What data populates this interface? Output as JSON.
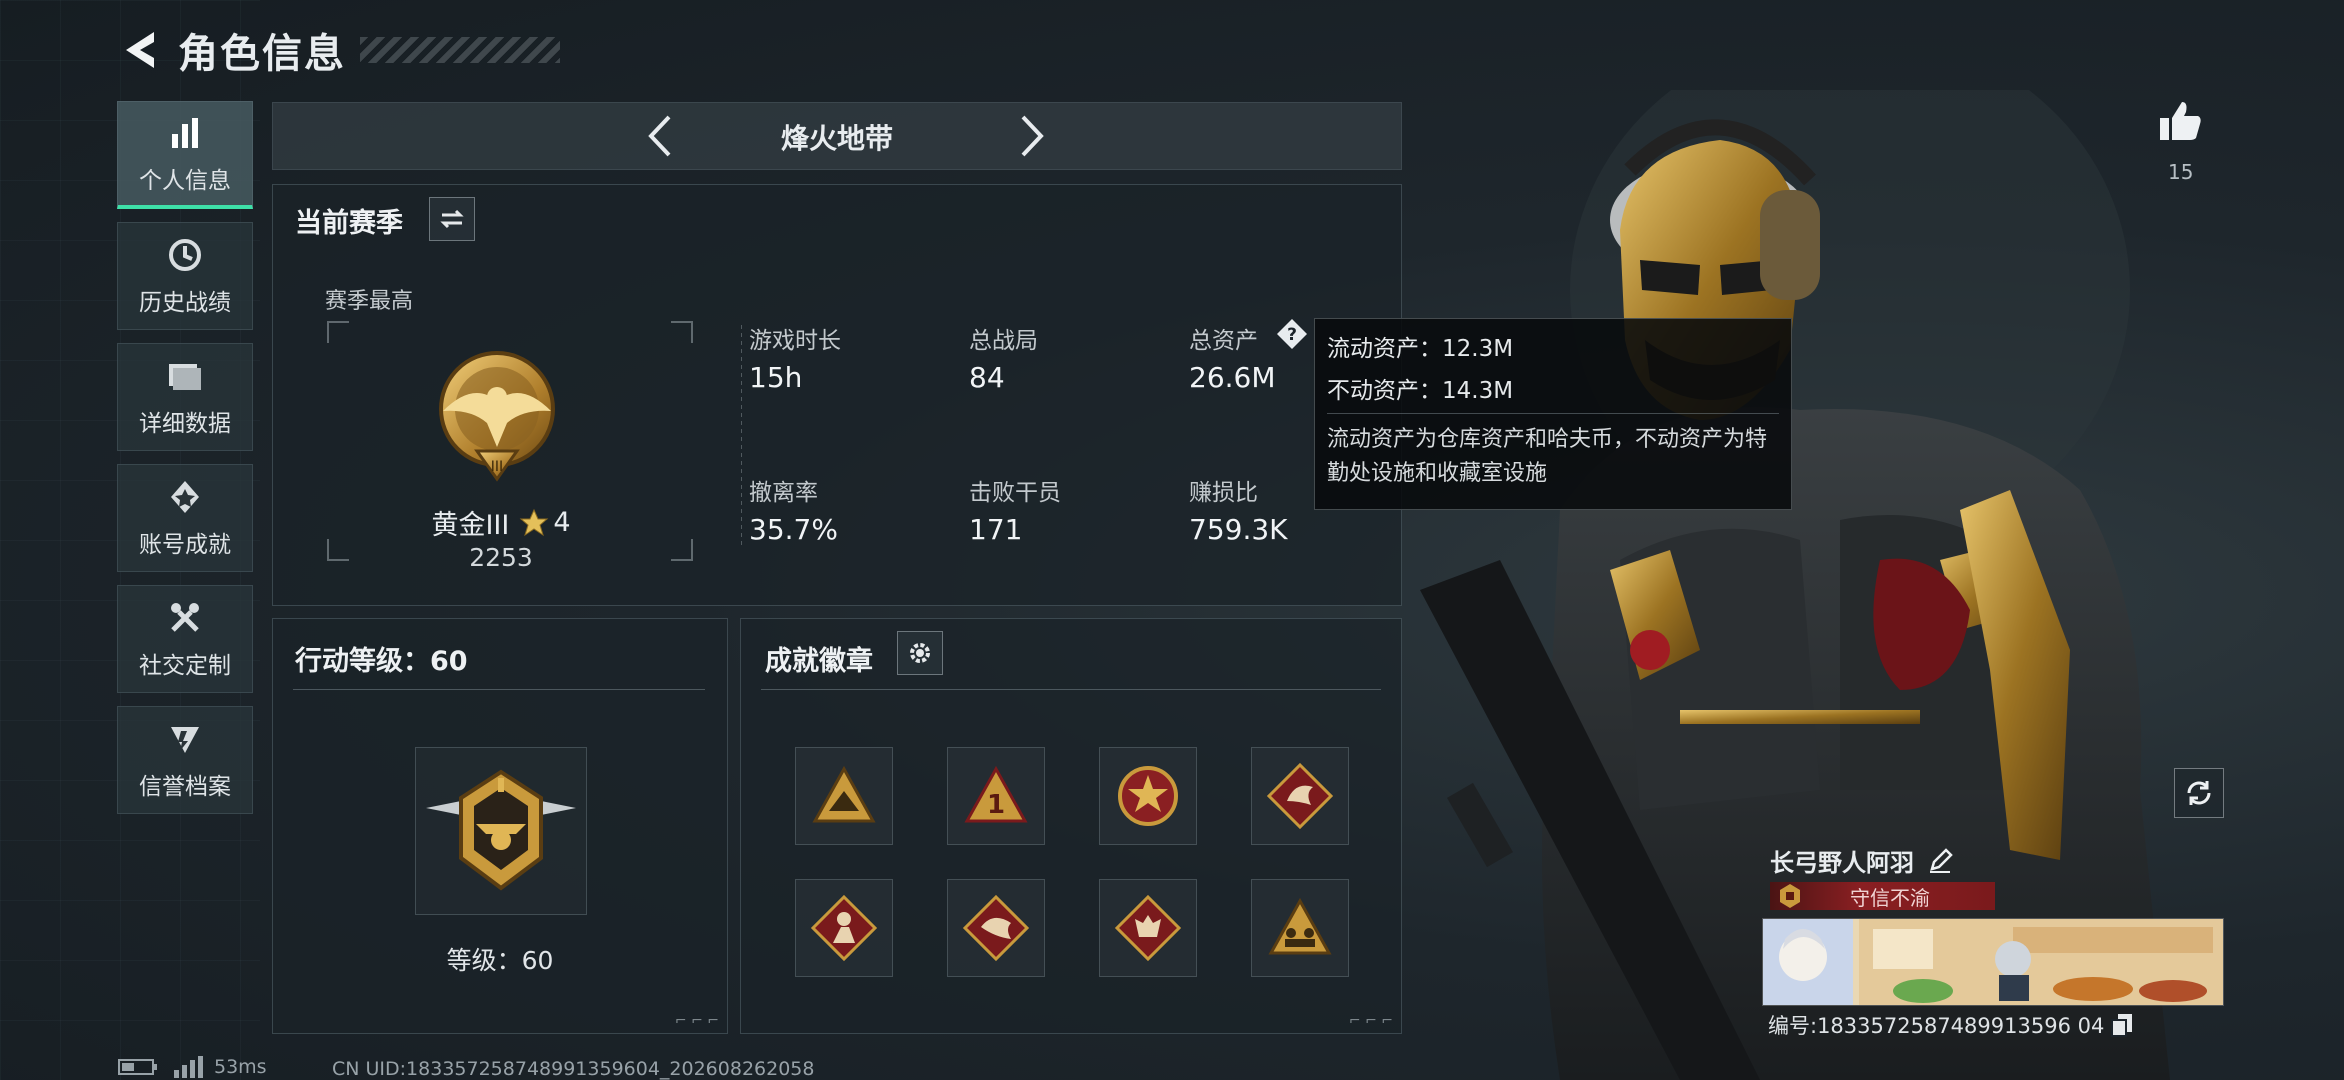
{
  "header": {
    "title": "角色信息"
  },
  "sidebar": {
    "items": [
      {
        "label": "个人信息",
        "icon": "bar-chart-icon",
        "active": true
      },
      {
        "label": "历史战绩",
        "icon": "history-icon",
        "active": false
      },
      {
        "label": "详细数据",
        "icon": "folder-icon",
        "active": false
      },
      {
        "label": "账号成就",
        "icon": "achievement-icon",
        "active": false
      },
      {
        "label": "社交定制",
        "icon": "tools-icon",
        "active": false
      },
      {
        "label": "信誉档案",
        "icon": "credit-icon",
        "active": false
      }
    ]
  },
  "mode_selector": {
    "title": "烽火地带"
  },
  "season": {
    "title": "当前赛季",
    "best_label": "赛季最高",
    "rank_name": "黄金III",
    "rank_stars": "4",
    "rank_score": "2253",
    "stats": [
      {
        "label": "游戏时长",
        "value": "15h"
      },
      {
        "label": "总战局",
        "value": "84"
      },
      {
        "label": "总资产",
        "value": "26.6M"
      },
      {
        "label": "撤离率",
        "value": "35.7%"
      },
      {
        "label": "击败干员",
        "value": "171"
      },
      {
        "label": "赚损比",
        "value": "759.3K"
      }
    ]
  },
  "tooltip": {
    "liquid": "流动资产：12.3M",
    "fixed": "不动资产：14.3M",
    "description": "流动资产为仓库资产和哈夫币，不动资产为特勤处设施和收藏室设施"
  },
  "action_level": {
    "title": "行动等级：60",
    "level_text": "等级：60"
  },
  "badges": {
    "title": "成就徽章",
    "items": [
      "badge-1",
      "badge-2",
      "badge-3",
      "badge-4",
      "badge-5",
      "badge-6",
      "badge-7",
      "badge-8"
    ]
  },
  "profile": {
    "likes": "15",
    "name": "长弓野人阿羽",
    "tag": "守信不渝",
    "id_text": "编号:1833572587489913596 04"
  },
  "footer": {
    "ping": "53ms",
    "uid": "CN UID:183357258748991359604_202608262058"
  },
  "colors": {
    "accent": "#3ee0a8",
    "gold": "#c99a3c",
    "tag_red": "#8a1f22"
  }
}
